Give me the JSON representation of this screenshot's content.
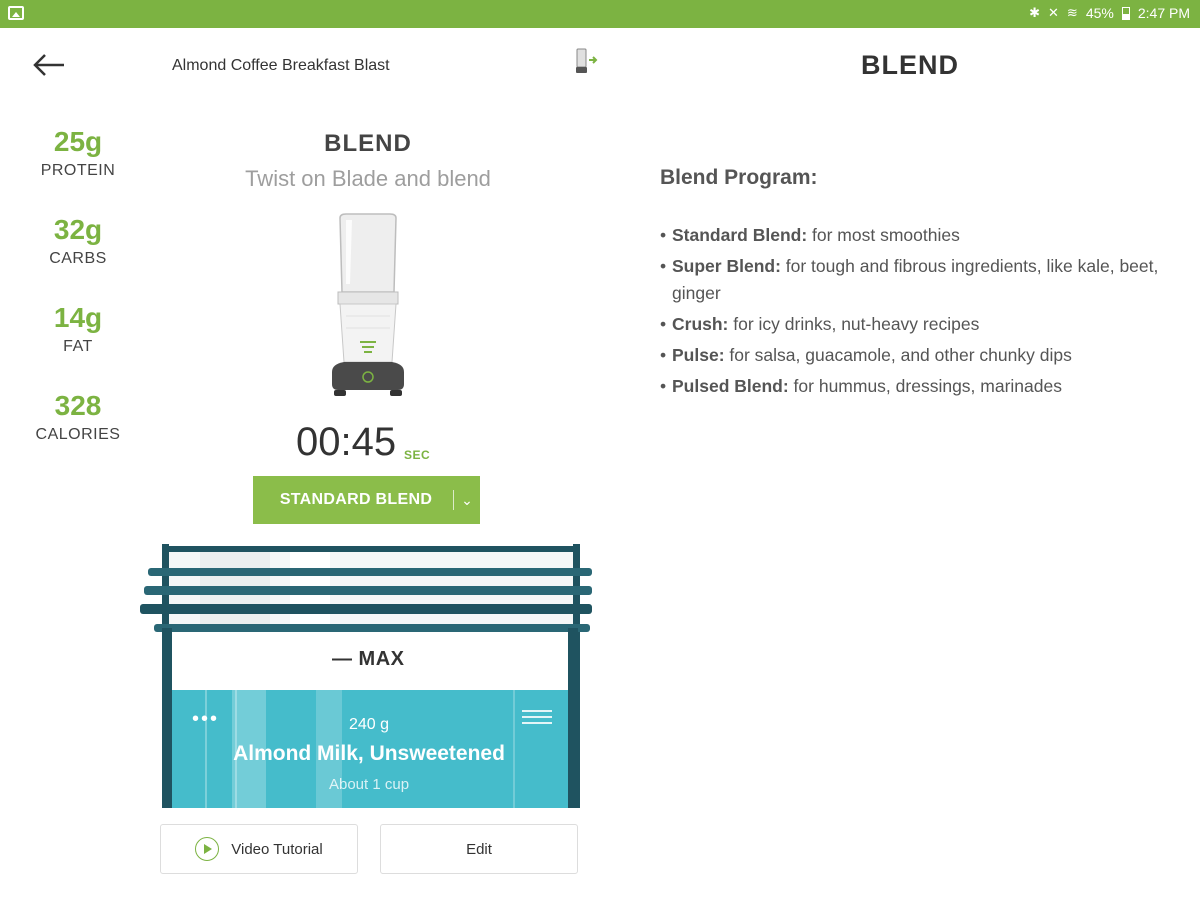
{
  "status_bar": {
    "battery": "45%",
    "time": "2:47 PM",
    "icons": [
      "gallery-icon",
      "bluetooth-icon",
      "mute-icon",
      "wifi-icon",
      "battery-icon"
    ]
  },
  "header": {
    "back_icon": "arrow-left-icon",
    "recipe_title": "Almond Coffee Breakfast Blast",
    "device_icon": "blender-connected-icon"
  },
  "nutrition": [
    {
      "value": "25g",
      "label": "PROTEIN"
    },
    {
      "value": "32g",
      "label": "CARBS"
    },
    {
      "value": "14g",
      "label": "FAT"
    },
    {
      "value": "328",
      "label": "CALORIES"
    }
  ],
  "step": {
    "title": "BLEND",
    "instruction": "Twist on Blade and blend",
    "timer": "00:45",
    "timer_unit": "SEC",
    "program": "STANDARD BLEND"
  },
  "jar": {
    "max_label": "— MAX",
    "ingredient": {
      "quantity": "240 g",
      "name": "Almond Milk, Unsweetened",
      "amount": "About 1 cup"
    }
  },
  "buttons": {
    "video": "Video Tutorial",
    "edit": "Edit"
  },
  "info_panel": {
    "heading": "BLEND",
    "program_title": "Blend Program:",
    "programs": [
      {
        "name": "Standard Blend:",
        "desc": " for most smoothies"
      },
      {
        "name": "Super Blend:",
        "desc": " for tough and fibrous ingredients, like kale, beet, ginger"
      },
      {
        "name": "Crush:",
        "desc": " for icy drinks, nut-heavy recipes"
      },
      {
        "name": "Pulse:",
        "desc": " for salsa, guacamole, and other chunky dips"
      },
      {
        "name": "Pulsed Blend:",
        "desc": " for hummus, dressings, marinades"
      }
    ]
  },
  "colors": {
    "accent": "#7cb342",
    "button_green": "#8bbd4a",
    "teal": "#45bccb",
    "jar_frame": "#1f5360"
  }
}
